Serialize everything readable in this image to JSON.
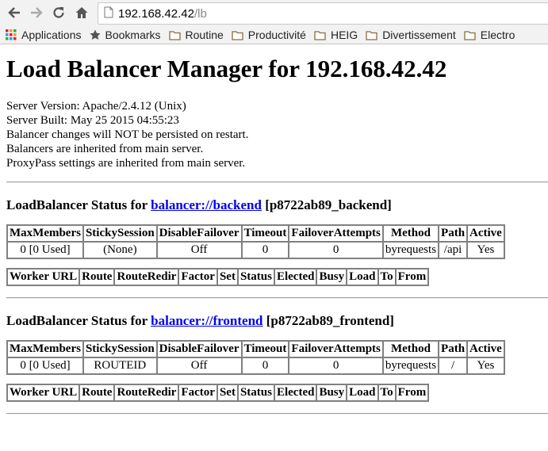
{
  "browser": {
    "address_host": "192.168.42.42",
    "address_path": "/lb",
    "bookmarks": [
      {
        "label": "Applications",
        "icon": "apps-grid-icon"
      },
      {
        "label": "Bookmarks",
        "icon": "star-icon"
      },
      {
        "label": "Routine",
        "icon": "folder-icon"
      },
      {
        "label": "Productivité",
        "icon": "folder-icon"
      },
      {
        "label": "HEIG",
        "icon": "folder-icon"
      },
      {
        "label": "Divertissement",
        "icon": "folder-icon"
      },
      {
        "label": "Electro",
        "icon": "folder-icon"
      }
    ]
  },
  "page": {
    "title": "Load Balancer Manager for 192.168.42.42",
    "info_lines": [
      "Server Version: Apache/2.4.12 (Unix)",
      "Server Built: May 25 2015 04:55:23",
      "Balancer changes will NOT be persisted on restart.",
      "Balancers are inherited from main server.",
      "ProxyPass settings are inherited from main server."
    ],
    "status_prefix": "LoadBalancer Status for",
    "status_headers": [
      "MaxMembers",
      "StickySession",
      "DisableFailover",
      "Timeout",
      "FailoverAttempts",
      "Method",
      "Path",
      "Active"
    ],
    "worker_headers": [
      "Worker URL",
      "Route",
      "RouteRedir",
      "Factor",
      "Set",
      "Status",
      "Elected",
      "Busy",
      "Load",
      "To",
      "From"
    ],
    "balancers": [
      {
        "link": "balancer://backend",
        "id": "[p8722ab89_backend]",
        "row": [
          "0 [0 Used]",
          "(None)",
          "Off",
          "0",
          "0",
          "byrequests",
          "/api",
          "Yes"
        ]
      },
      {
        "link": "balancer://frontend",
        "id": "[p8722ab89_frontend]",
        "row": [
          "0 [0 Used]",
          "ROUTEID",
          "Off",
          "0",
          "0",
          "byrequests",
          "/",
          "Yes"
        ]
      }
    ]
  }
}
